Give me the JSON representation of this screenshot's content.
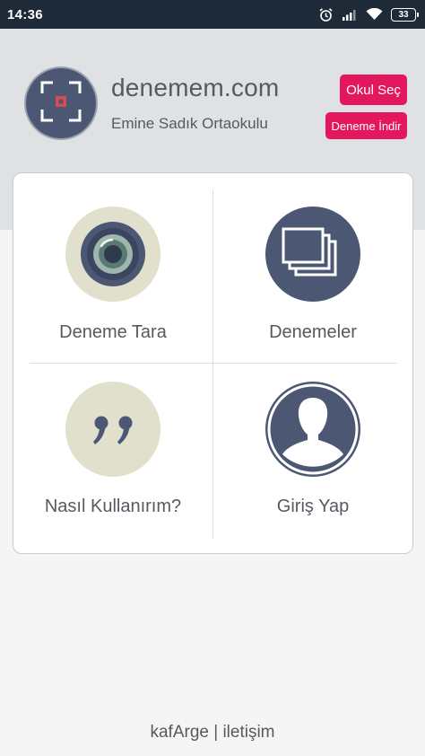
{
  "status_bar": {
    "time": "14:36",
    "battery": "33",
    "icons": [
      "alarm-icon",
      "signal-icon",
      "wifi-icon",
      "battery-icon"
    ]
  },
  "header": {
    "title": "denemem.com",
    "school": "Emine Sadık Ortaokulu",
    "logo_icon": "scan-frame-icon",
    "select_school_label": "Okul Seç",
    "download_exam_label": "Deneme İndir"
  },
  "menu": {
    "items": [
      {
        "label": "Deneme Tara",
        "icon": "camera-lens-icon"
      },
      {
        "label": "Denemeler",
        "icon": "stacked-pages-icon"
      },
      {
        "label": "Nasıl Kullanırım?",
        "icon": "quote-icon"
      },
      {
        "label": "Giriş Yap",
        "icon": "user-silhouette-icon"
      }
    ]
  },
  "footer": {
    "brand": "kafArge",
    "separator": "|",
    "contact": "iletişim"
  },
  "colors": {
    "status_bar": "#1e2a38",
    "header_bg": "#dfe1e3",
    "accent_pink": "#e3175e",
    "icon_navy": "#4c5873",
    "icon_beige": "#e1e0cd",
    "text_gray": "#555a60"
  }
}
